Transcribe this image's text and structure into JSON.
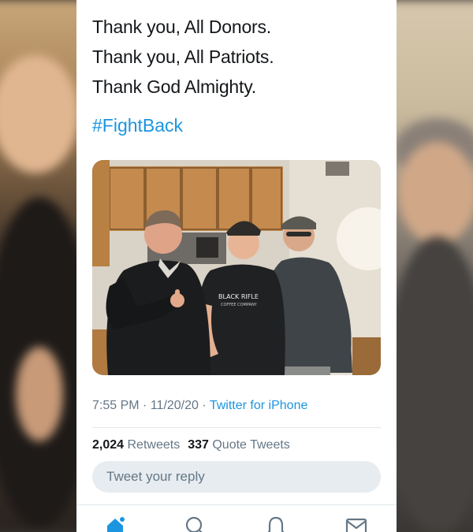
{
  "tweet": {
    "lines": [
      "Thank you, All Donors.",
      "Thank you, All Patriots.",
      "Thank God Almighty."
    ],
    "hashtag": "#FightBack",
    "photo_shirt_text": "BLACK RIFLE",
    "photo_shirt_subtext": "COFFEE COMPANY"
  },
  "meta": {
    "time": "7:55 PM",
    "separator": "·",
    "date": "11/20/20",
    "source": "Twitter for iPhone"
  },
  "stats": {
    "retweets_count": "2,024",
    "retweets_label": "Retweets",
    "quotes_count": "337",
    "quotes_label": "Quote Tweets"
  },
  "reply": {
    "placeholder": "Tweet your reply"
  },
  "tabbar": {
    "icons": [
      "home-icon",
      "search-icon",
      "notifications-icon",
      "messages-icon"
    ]
  },
  "colors": {
    "link": "#1b95e0",
    "text": "#14171a",
    "muted": "#657786",
    "reply_bg": "#e6ecf0"
  }
}
